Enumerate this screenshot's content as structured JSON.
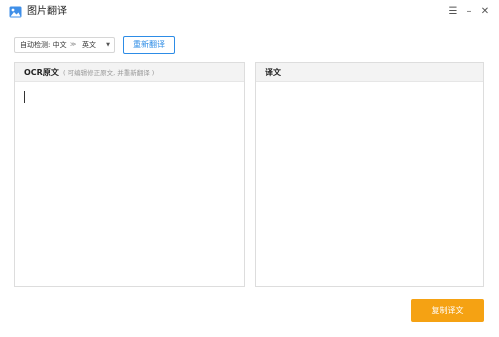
{
  "app": {
    "title": "图片翻译",
    "icon": "image-icon",
    "window_buttons": {
      "menu": "☰",
      "minimize": "–",
      "close": "✕"
    }
  },
  "toolbar": {
    "detect_label": "自动检测: 中文",
    "direction_arrows": "≫",
    "target_language": "英文",
    "dropdown_caret": "▼",
    "retranslate_label": "重新翻译"
  },
  "source_panel": {
    "title": "OCR原文",
    "hint": "( 可编辑修正原文, 并重新翻译 )",
    "text": ""
  },
  "target_panel": {
    "title": "译文",
    "text": ""
  },
  "actions": {
    "copy_label": "复制译文"
  },
  "colors": {
    "accent_blue": "#2d8ce6",
    "copy_button": "#f5a213",
    "panel_header_bg": "#f3f3f3",
    "border": "#dddddd"
  }
}
